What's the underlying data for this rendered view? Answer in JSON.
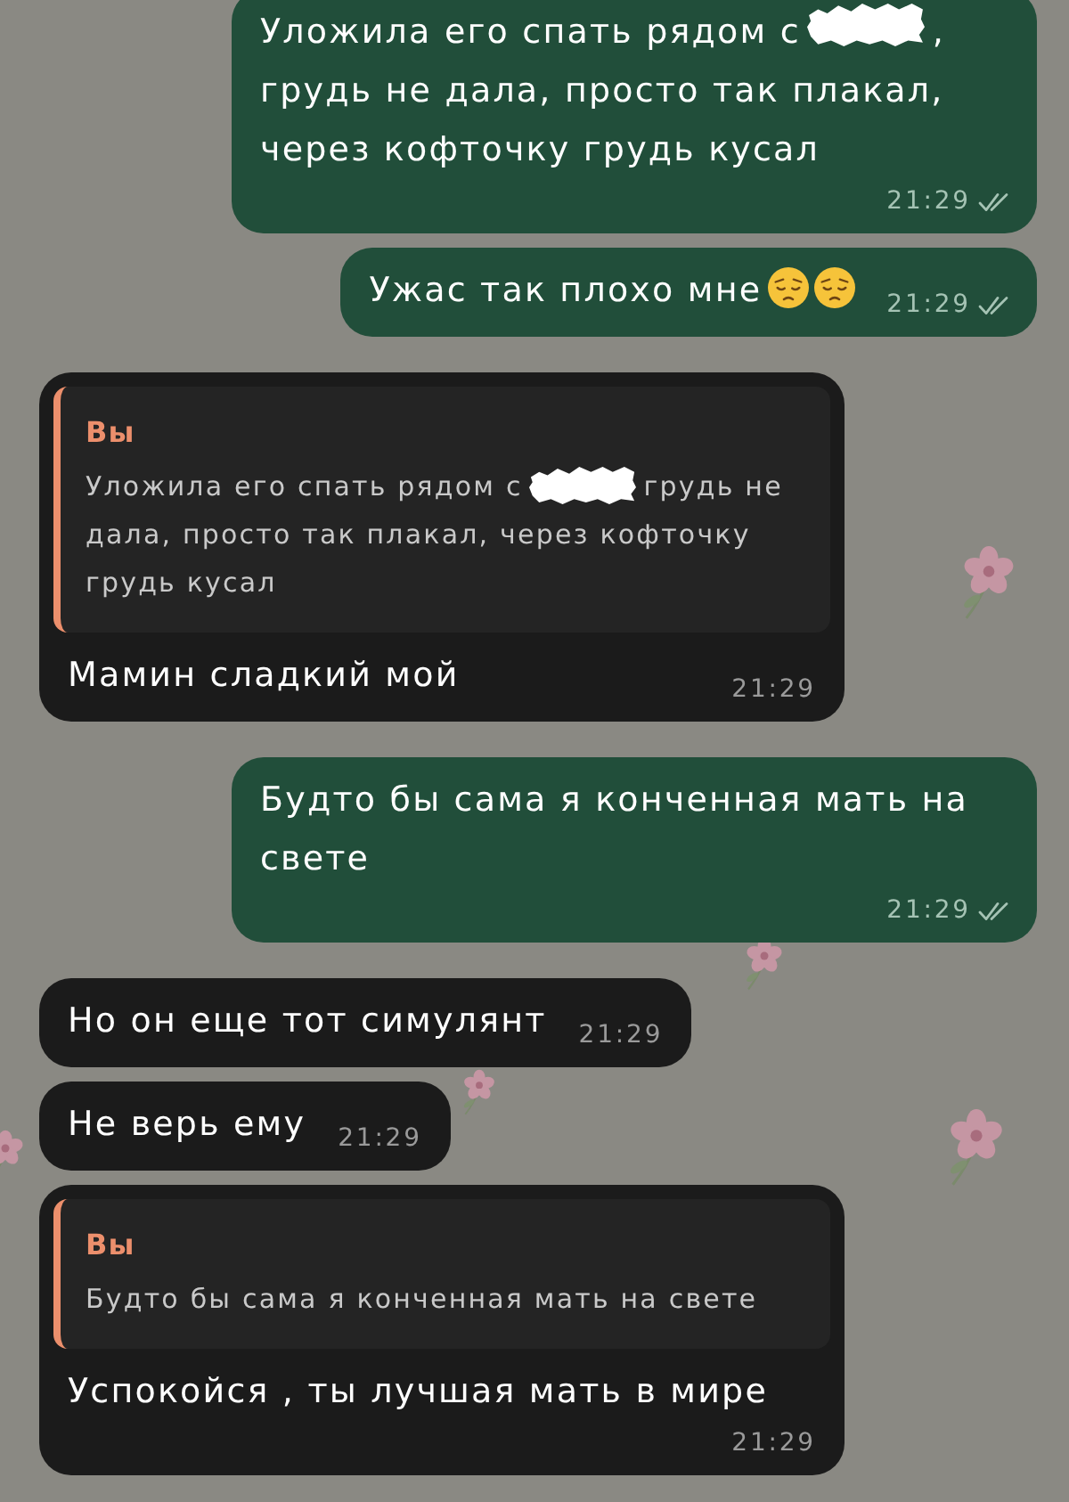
{
  "messages": [
    {
      "kind": "outgoing",
      "parts": [
        {
          "kind": "text",
          "text": "Уложила его спать рядом с"
        },
        {
          "kind": "redaction"
        },
        {
          "kind": "text",
          "text": ", грудь не дала, просто так плакал, через кофточку грудь кусал"
        }
      ],
      "time": "21:29",
      "read": true
    },
    {
      "kind": "outgoing",
      "parts": [
        {
          "kind": "text",
          "text": "Ужас так плохо мне"
        },
        {
          "kind": "emoji"
        },
        {
          "kind": "emoji"
        }
      ],
      "time": "21:29",
      "read": true
    },
    {
      "kind": "incoming",
      "reply": {
        "author": "Вы",
        "parts": [
          {
            "kind": "text",
            "text": "Уложила его спать рядом с"
          },
          {
            "kind": "redaction"
          },
          {
            "kind": "text",
            "text": "грудь не дала, просто так плакал, через кофточку грудь кусал"
          }
        ]
      },
      "parts": [
        {
          "kind": "text",
          "text": "Мамин сладкий мой"
        }
      ],
      "time": "21:29"
    },
    {
      "kind": "outgoing",
      "parts": [
        {
          "kind": "text",
          "text": "Будто бы сама я конченная мать на свете"
        }
      ],
      "time": "21:29",
      "read": true
    },
    {
      "kind": "incoming",
      "parts": [
        {
          "kind": "text",
          "text": "Но он еще тот симулянт"
        }
      ],
      "time": "21:29"
    },
    {
      "kind": "incoming",
      "parts": [
        {
          "kind": "text",
          "text": "Не верь ему"
        }
      ],
      "time": "21:29"
    },
    {
      "kind": "incoming",
      "reply": {
        "author": "Вы",
        "parts": [
          {
            "kind": "text",
            "text": "Будто бы сама я конченная мать на свете"
          }
        ]
      },
      "parts": [
        {
          "kind": "text",
          "text": "Успокойся , ты лучшая мать в мире"
        }
      ],
      "time": "21:29"
    }
  ]
}
